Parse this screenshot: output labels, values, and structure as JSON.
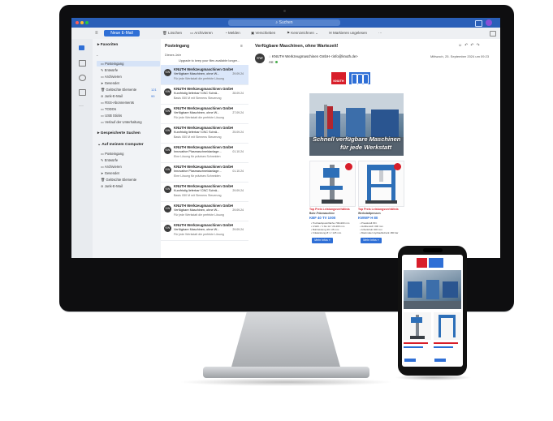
{
  "window": {
    "search_placeholder": "Suchen"
  },
  "toolbar": {
    "new_mail": "Neue E-Mail",
    "items": [
      "Löschen",
      "Archivieren",
      "Melden",
      "Verschieben",
      "Kennzeichnen",
      "Markieren ungelesen",
      "···"
    ]
  },
  "folders": {
    "favorites_header": "Favoriten",
    "favorites": [
      {
        "label": "Posteingang",
        "count": ""
      },
      {
        "label": "Entwürfe",
        "count": ""
      },
      {
        "label": "Archivieren",
        "count": ""
      },
      {
        "label": "Gesendet",
        "count": ""
      },
      {
        "label": "Gelöschte Elemente",
        "count": "121"
      },
      {
        "label": "Junk-E-Mail",
        "count": "99"
      },
      {
        "label": "RSS-Abonnements",
        "count": ""
      },
      {
        "label": "TODOs",
        "count": ""
      },
      {
        "label": "USB Sticks",
        "count": ""
      },
      {
        "label": "Verlauf der Unterhaltung",
        "count": ""
      }
    ],
    "saved_searches_header": "Gespeicherte Suchen",
    "on_my_computer_header": "Auf meinem Computer",
    "local": [
      {
        "label": "Posteingang"
      },
      {
        "label": "Entwürfe"
      },
      {
        "label": "Archivieren"
      },
      {
        "label": "Gesendet"
      },
      {
        "label": "Gelöschte Elemente"
      },
      {
        "label": "Junk-E-Mail"
      }
    ]
  },
  "message_list": {
    "title": "Posteingang",
    "section": "Dieses Jahr",
    "upgrade_line": "Upgrade to keep your files available longer...",
    "messages": [
      {
        "from": "KNUTH Werkzeugmaschinen GmbH",
        "subject": "Verfügbare Maschinen, ohne W...",
        "date": "29.09.24",
        "preview": "Für jede Werkstatt die perfekte Lösung"
      },
      {
        "from": "KNUTH Werkzeugmaschinen GmbH",
        "subject": "Kurzfristig lieferbar! CNC Schrä...",
        "date": "28.09.24",
        "preview": "Basis X50 M mit Siemens Steuerung"
      },
      {
        "from": "KNUTH Werkzeugmaschinen GmbH",
        "subject": "Verfügbare Maschinen, ohne W...",
        "date": "27.09.24",
        "preview": "Für jede Werkstatt die perfekte Lösung"
      },
      {
        "from": "KNUTH Werkzeugmaschinen GmbH",
        "subject": "Kurzfristig lieferbar! CNC Schrä...",
        "date": "25.09.24",
        "preview": "Basis X50 M mit Siemens Steuerung"
      },
      {
        "from": "KNUTH Werkzeugmaschinen GmbH",
        "subject": "Innovative Plasmaschneidanlage...",
        "date": "01.10.24",
        "preview": "Eine Lösung für präzises Schneiden"
      },
      {
        "from": "KNUTH Werkzeugmaschinen GmbH",
        "subject": "Innovative Plasmaschneidanlage...",
        "date": "01.10.24",
        "preview": "Eine Lösung für präzises Schneiden"
      },
      {
        "from": "KNUTH Werkzeugmaschinen GmbH",
        "subject": "Kurzfristig lieferbar! CNC Schrä...",
        "date": "29.09.24",
        "preview": "Basis X50 M mit Siemens Steuerung"
      },
      {
        "from": "KNUTH Werkzeugmaschinen GmbH",
        "subject": "Verfügbare Maschinen, ohne W...",
        "date": "29.09.24",
        "preview": "Für jede Werkstatt die perfekte Lösung"
      },
      {
        "from": "KNUTH Werkzeugmaschinen GmbH",
        "subject": "Verfügbare Maschinen, ohne W...",
        "date": "29.09.24",
        "preview": "Für jede Werkstatt die perfekte Lösung"
      }
    ]
  },
  "reading_pane": {
    "subject": "Verfügbare Maschinen, ohne Wartezeit!",
    "from": "KNUTH Werkzeugmaschinen GmbH <info@knuth.de>",
    "to_label": "An:",
    "date": "Mittwoch, 25. September 2024 um 09:23",
    "avatar_initials": "KW"
  },
  "email": {
    "brand": "KNUTH",
    "hero_line1": "Schnell verfügbare Maschinen",
    "hero_line2": "für jede Werkstatt",
    "products": [
      {
        "tag": "Top Preis Leistungsverhältnis",
        "category": "Bohr-Fräsmaschine",
        "name": "KBF 40 TV 1000",
        "specs": [
          "• Tischaufspannfläche 700x200 mm",
          "• 4-Wdr. / 1 bis 12 / 20-200 mm",
          "• Bohrleistung 40 / 25 mm",
          "• Fräsleistung Ø 1 / 125 mm"
        ],
        "button": "Mehr Infos »"
      },
      {
        "tag": "Top Preis Leistungsverhältnis",
        "category": "Werkstattpressen",
        "name": "KWWP H 80",
        "specs": [
          "• Presskraft 80 t",
          "• Hubbereich 300 mm",
          "• Arbeitshub 400 mm",
          "• Maximaler Hydraulikdruck 180 bar"
        ],
        "button": "Mehr Infos »"
      }
    ]
  },
  "colors": {
    "accent": "#2f6fd6",
    "titlebar": "#2a5fb8",
    "brand_red": "#d81e2a"
  }
}
